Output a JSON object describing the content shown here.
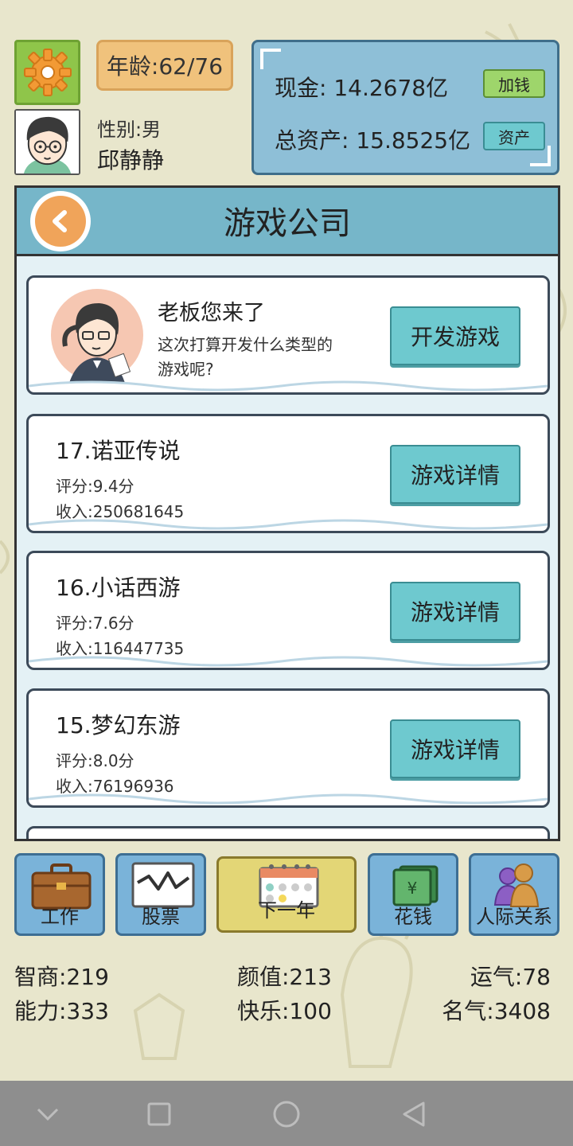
{
  "profile": {
    "age": "年龄:62/76",
    "gender": "性别:男",
    "name": "邱静静"
  },
  "money": {
    "cash": "现金: 14.2678亿",
    "total_assets": "总资产: 15.8525亿",
    "add_money_btn": "加钱",
    "assets_btn": "资产"
  },
  "panel": {
    "title": "游戏公司"
  },
  "boss_card": {
    "greeting": "老板您来了",
    "question_line1": "这次打算开发什么类型的",
    "question_line2": "游戏呢?",
    "develop_btn": "开发游戏"
  },
  "games": [
    {
      "title": "17.诺亚传说",
      "score": "评分:9.4分",
      "income": "收入:250681645",
      "btn": "游戏详情"
    },
    {
      "title": "16.小话西游",
      "score": "评分:7.6分",
      "income": "收入:116447735",
      "btn": "游戏详情"
    },
    {
      "title": "15.梦幻东游",
      "score": "评分:8.0分",
      "income": "收入:76196936",
      "btn": "游戏详情"
    }
  ],
  "nav": {
    "work": "工作",
    "stocks": "股票",
    "next_year": "下一年",
    "spend": "花钱",
    "relations": "人际关系"
  },
  "stats": {
    "iq": "智商:219",
    "looks": "颜值:213",
    "luck": "运气:78",
    "ability": "能力:333",
    "happiness": "快乐:100",
    "fame": "名气:3408"
  }
}
